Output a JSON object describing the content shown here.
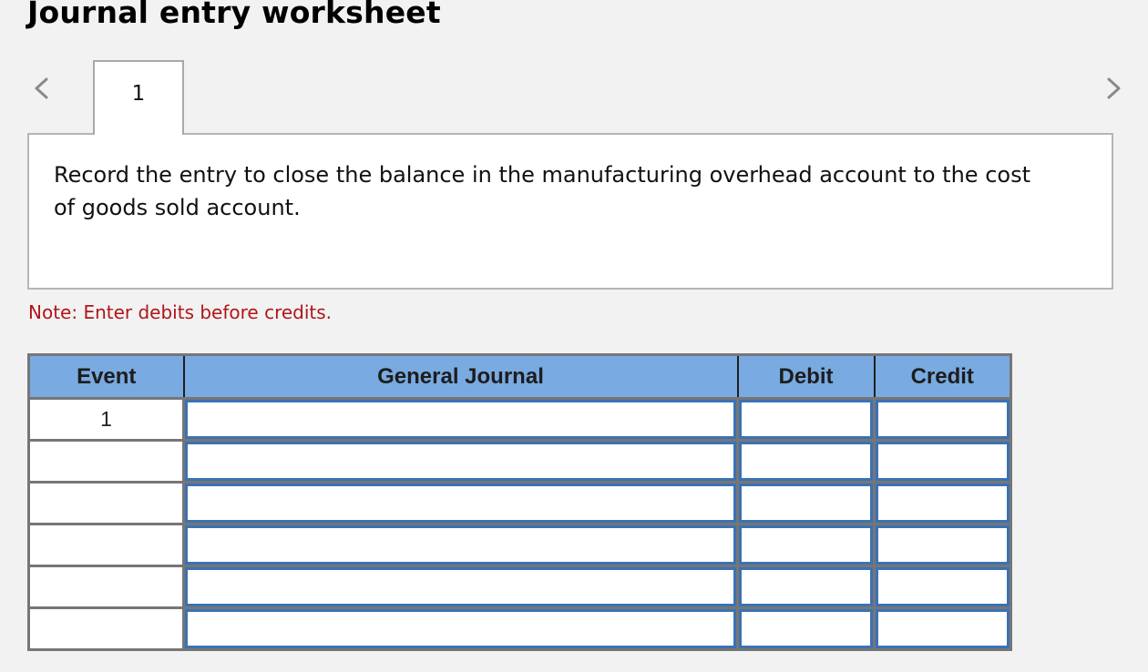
{
  "page": {
    "title": "Journal entry worksheet"
  },
  "navigation": {
    "prev_icon": "chevron-left-icon",
    "next_icon": "chevron-right-icon",
    "tabs": [
      {
        "label": "1",
        "active": true
      }
    ]
  },
  "instruction": {
    "text": "Record the entry to close the balance in the manufacturing overhead account to the cost of goods sold account."
  },
  "note": {
    "text": "Note: Enter debits before credits.",
    "color": "#b0151a"
  },
  "journal_table": {
    "header_color": "#79aae1",
    "input_border_color": "#3a72b4",
    "columns": [
      "Event",
      "General Journal",
      "Debit",
      "Credit"
    ],
    "rows": [
      {
        "event": "1",
        "general_journal": "",
        "debit": "",
        "credit": ""
      },
      {
        "event": "",
        "general_journal": "",
        "debit": "",
        "credit": ""
      },
      {
        "event": "",
        "general_journal": "",
        "debit": "",
        "credit": ""
      },
      {
        "event": "",
        "general_journal": "",
        "debit": "",
        "credit": ""
      },
      {
        "event": "",
        "general_journal": "",
        "debit": "",
        "credit": ""
      },
      {
        "event": "",
        "general_journal": "",
        "debit": "",
        "credit": ""
      }
    ]
  }
}
